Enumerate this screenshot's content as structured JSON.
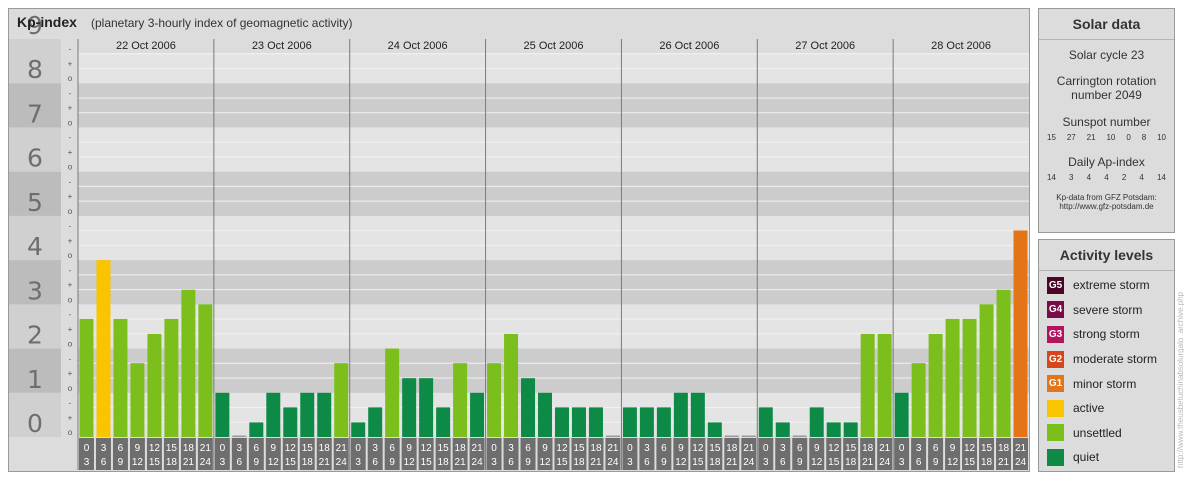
{
  "header": {
    "title": "Kp-index",
    "subtitle": "(planetary 3-hourly index of geomagnetic activity)"
  },
  "chart_data": {
    "type": "bar",
    "y_axis": {
      "range": [
        0,
        9
      ],
      "labels": [
        "0",
        "1",
        "2",
        "3",
        "4",
        "5",
        "6",
        "7",
        "8",
        "9"
      ],
      "minor_labels": [
        "o",
        "+",
        "-"
      ]
    },
    "days": [
      {
        "date": "22 Oct 2006",
        "values": [
          2.67,
          4.0,
          2.67,
          1.67,
          2.33,
          2.67,
          3.33,
          3.0
        ]
      },
      {
        "date": "23 Oct 2006",
        "values": [
          1.0,
          0.0,
          0.33,
          1.0,
          0.67,
          1.0,
          1.0,
          1.67
        ]
      },
      {
        "date": "24 Oct 2006",
        "values": [
          0.33,
          0.67,
          2.0,
          1.33,
          1.33,
          0.67,
          1.67,
          1.0
        ]
      },
      {
        "date": "25 Oct 2006",
        "values": [
          1.67,
          2.33,
          1.33,
          1.0,
          0.67,
          0.67,
          0.67,
          0.0
        ]
      },
      {
        "date": "26 Oct 2006",
        "values": [
          0.67,
          0.67,
          0.67,
          1.0,
          1.0,
          0.33,
          0.0,
          0.0
        ]
      },
      {
        "date": "27 Oct 2006",
        "values": [
          0.67,
          0.33,
          0.0,
          0.67,
          0.33,
          0.33,
          2.33,
          2.33
        ]
      },
      {
        "date": "28 Oct 2006",
        "values": [
          1.0,
          1.67,
          2.33,
          2.67,
          2.67,
          3.0,
          3.33,
          4.67
        ]
      }
    ],
    "hour_labels": [
      [
        "0",
        "3"
      ],
      [
        "3",
        "6"
      ],
      [
        "6",
        "9"
      ],
      [
        "9",
        "12"
      ],
      [
        "12",
        "15"
      ],
      [
        "15",
        "18"
      ],
      [
        "18",
        "21"
      ],
      [
        "21",
        "24"
      ]
    ],
    "level_colors": {
      "quiet": "#0d8a45",
      "unsettled": "#7cbf1c",
      "active": "#f9c400",
      "minor": "#e37418",
      "moderate": "#d9451a",
      "strong": "#b3145d",
      "severe": "#7a0a4a",
      "extreme": "#4a0627"
    },
    "grid": true
  },
  "solar": {
    "title": "Solar data",
    "cycle": "Solar cycle 23",
    "carrington_1": "Carrington rotation",
    "carrington_2": "number 2049",
    "sunspot_label": "Sunspot number",
    "sunspot_values": [
      "15",
      "27",
      "21",
      "10",
      "0",
      "8",
      "10"
    ],
    "ap_label": "Daily Ap-index",
    "ap_values": [
      "14",
      "3",
      "4",
      "4",
      "2",
      "4",
      "14"
    ],
    "source_1": "Kp-data from GFZ Potsdam:",
    "source_2": "http://www.gfz-potsdam.de"
  },
  "activity": {
    "title": "Activity levels",
    "levels": [
      {
        "badge": "G5",
        "label": "extreme storm",
        "color": "#4a0627"
      },
      {
        "badge": "G4",
        "label": "severe storm",
        "color": "#7a0a4a"
      },
      {
        "badge": "G3",
        "label": "strong storm",
        "color": "#b3145d"
      },
      {
        "badge": "G2",
        "label": "moderate storm",
        "color": "#d9451a"
      },
      {
        "badge": "G1",
        "label": "minor storm",
        "color": "#e37418"
      },
      {
        "badge": "",
        "label": "active",
        "color": "#f9c400"
      },
      {
        "badge": "",
        "label": "unsettled",
        "color": "#7cbf1c"
      },
      {
        "badge": "",
        "label": "quiet",
        "color": "#0d8a45"
      }
    ]
  },
  "watermark": "http://www.theusbetuchinabsolurgalo_archive.php"
}
